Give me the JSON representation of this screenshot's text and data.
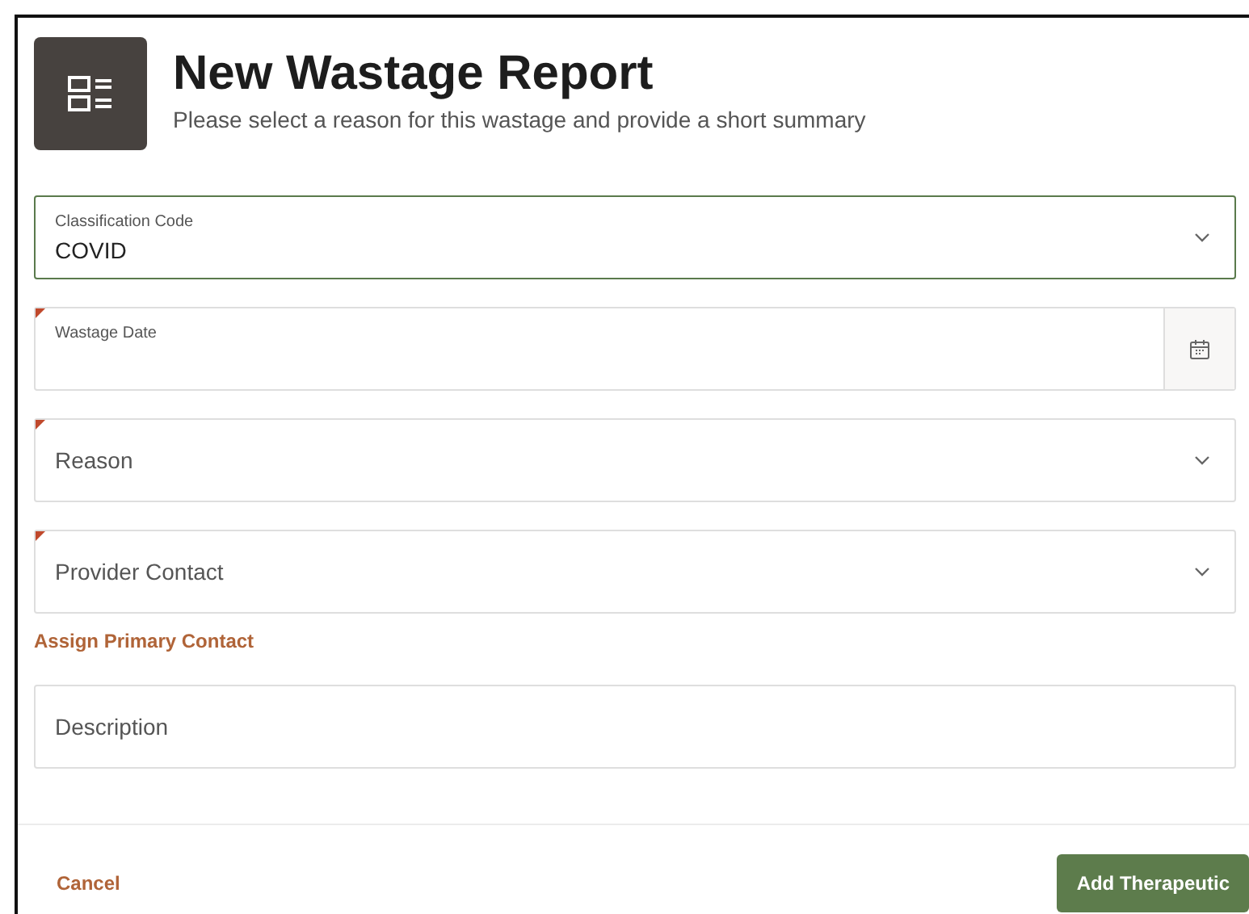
{
  "header": {
    "title": "New Wastage Report",
    "subtitle": "Please select a reason for this wastage and provide a short summary"
  },
  "fields": [
    {
      "kind": "select",
      "label": "Classification Code",
      "value": "COVID",
      "required": false,
      "focused": true
    },
    {
      "kind": "date",
      "label": "Wastage Date",
      "required": true,
      "focused": false
    },
    {
      "kind": "select",
      "label": "Reason",
      "required": true,
      "focused": false
    },
    {
      "kind": "select",
      "label": "Provider Contact",
      "required": true,
      "focused": false
    },
    {
      "kind": "link",
      "label": "Assign Primary Contact"
    },
    {
      "kind": "text",
      "label": "Description",
      "required": false,
      "focused": false
    }
  ],
  "footer": {
    "cancel": "Cancel",
    "submit": "Add Therapeutic"
  }
}
